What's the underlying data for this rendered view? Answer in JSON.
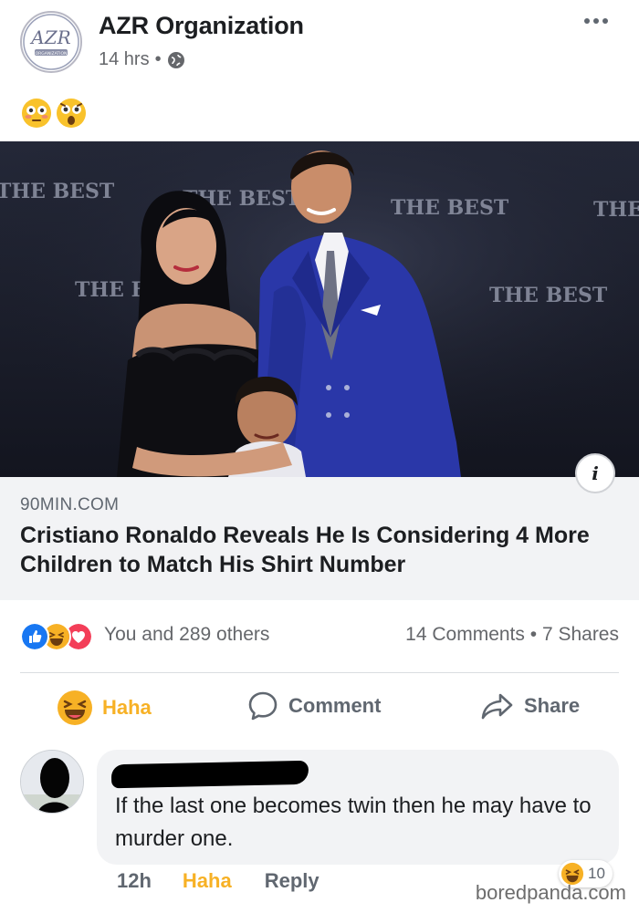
{
  "post": {
    "author": "AZR Organization",
    "logo_text": "AZR",
    "logo_subtext": "ORGANIZATION",
    "time": "14 hrs",
    "separator": "•",
    "privacy_icon": "globe-icon",
    "caption_emojis": [
      "flushed-face-emoji",
      "astonished-face-emoji"
    ]
  },
  "photo": {
    "backdrop_text": [
      "THE BEST",
      "THE BEST",
      "THE BEST",
      "THE BEST",
      "THE BEST",
      "THE BEST"
    ]
  },
  "link": {
    "domain": "90MIN.COM",
    "title": "Cristiano Ronaldo Reveals He Is Considering 4 More Children to Match His Shirt Number",
    "info_label": "i"
  },
  "reactions": {
    "icons": [
      "like-icon",
      "haha-icon",
      "love-icon"
    ],
    "summary": "You and 289 others",
    "comments": "14 Comments",
    "shares": "7 Shares",
    "dot": "•"
  },
  "actions": {
    "haha": "Haha",
    "comment": "Comment",
    "share": "Share"
  },
  "comment": {
    "text": "If the last one becomes twin then he may have to murder one.",
    "time": "12h",
    "haha": "Haha",
    "reply": "Reply",
    "reaction_count": "10"
  },
  "watermark": "boredpanda.com",
  "colors": {
    "haha": "#f7b125",
    "like": "#1877f2",
    "love": "#f33e58",
    "suit": "#2a37a8",
    "backdrop": "#1a1d2a"
  }
}
